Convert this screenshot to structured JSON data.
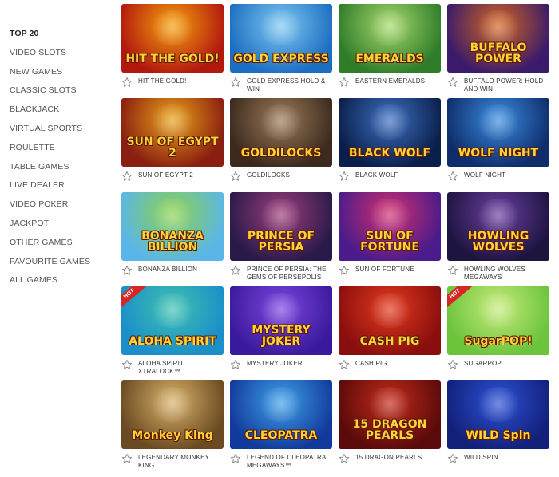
{
  "sidebar": {
    "items": [
      {
        "label": "TOP 20",
        "active": true
      },
      {
        "label": "VIDEO SLOTS"
      },
      {
        "label": "NEW GAMES"
      },
      {
        "label": "CLASSIC SLOTS"
      },
      {
        "label": "BLACKJACK"
      },
      {
        "label": "VIRTUAL SPORTS"
      },
      {
        "label": "ROULETTE"
      },
      {
        "label": "TABLE GAMES"
      },
      {
        "label": "LIVE DEALER"
      },
      {
        "label": "VIDEO POKER"
      },
      {
        "label": "JACKPOT"
      },
      {
        "label": "OTHER GAMES"
      },
      {
        "label": "FAVOURITE GAMES"
      },
      {
        "label": "ALL GAMES"
      }
    ]
  },
  "games": [
    {
      "title": "HIT THE GOLD!",
      "art_text": "HIT THE GOLD!",
      "bg1": "#b3180f",
      "bg2": "#f5a20b",
      "hot": false
    },
    {
      "title": "GOLD EXPRESS HOLD & WIN",
      "art_text": "GOLD EXPRESS",
      "bg1": "#1c6ec2",
      "bg2": "#7ec8f0",
      "hot": false
    },
    {
      "title": "EASTERN EMERALDS",
      "art_text": "EMERALDS",
      "bg1": "#2f7d2a",
      "bg2": "#a7d86b",
      "hot": false
    },
    {
      "title": "BUFFALO POWER: HOLD AND WIN",
      "art_text": "BUFFALO POWER",
      "bg1": "#3a1a6b",
      "bg2": "#d3651f",
      "hot": false
    },
    {
      "title": "SUN OF EGYPT 2",
      "art_text": "SUN OF EGYPT 2",
      "bg1": "#8a1e10",
      "bg2": "#e8a21a",
      "hot": false
    },
    {
      "title": "GOLDILOCKS",
      "art_text": "GOLDILOCKS",
      "bg1": "#3c2a1e",
      "bg2": "#9c7a58",
      "hot": false
    },
    {
      "title": "BLACK WOLF",
      "art_text": "BLACK WOLF",
      "bg1": "#0a1f4a",
      "bg2": "#3d6fc1",
      "hot": false
    },
    {
      "title": "WOLF NIGHT",
      "art_text": "WOLF NIGHT",
      "bg1": "#0f2d6b",
      "bg2": "#3a8be0",
      "hot": false
    },
    {
      "title": "BONANZA BILLION",
      "art_text": "BONANZA BILLION",
      "bg1": "#5bb6e8",
      "bg2": "#8bd14a",
      "hot": false
    },
    {
      "title": "PRINCE OF PERSIA: THE GEMS OF PERSEPOLIS",
      "art_text": "PRINCE OF PERSIA",
      "bg1": "#2a1a4a",
      "bg2": "#9c3d7a",
      "hot": false
    },
    {
      "title": "SUN OF FORTUNE",
      "art_text": "SUN OF FORTUNE",
      "bg1": "#4a1b8a",
      "bg2": "#d12f6e",
      "hot": false
    },
    {
      "title": "HOWLING WOLVES MEGAWAYS",
      "art_text": "HOWLING WOLVES",
      "bg1": "#1e1440",
      "bg2": "#6a3fa0",
      "hot": false
    },
    {
      "title": "ALOHA SPIRIT XTRALOCK™",
      "art_text": "ALOHA SPIRIT",
      "bg1": "#1a8fc9",
      "bg2": "#3fc0b0",
      "hot": true
    },
    {
      "title": "MYSTERY JOKER",
      "art_text": "MYSTERY JOKER",
      "bg1": "#3a1a9c",
      "bg2": "#7d46e0",
      "hot": false
    },
    {
      "title": "CASH PIG",
      "art_text": "CASH PIG",
      "bg1": "#8a0e0e",
      "bg2": "#e23a1d",
      "hot": false
    },
    {
      "title": "SUGARPOP",
      "art_text": "SugarPOP!",
      "bg1": "#6bc43c",
      "bg2": "#c6ea7a",
      "hot": true
    },
    {
      "title": "LEGENDARY MONKEY KING",
      "art_text": "Monkey King",
      "bg1": "#6a4a22",
      "bg2": "#d9b36a",
      "hot": false
    },
    {
      "title": "LEGEND OF CLEOPATRA MEGAWAYS™",
      "art_text": "CLEOPATRA",
      "bg1": "#123a9c",
      "bg2": "#3fa0e8",
      "hot": false
    },
    {
      "title": "15 DRAGON PEARLS",
      "art_text": "15 DRAGON PEARLS",
      "bg1": "#5a0a0a",
      "bg2": "#c22a1a",
      "hot": false
    },
    {
      "title": "WILD SPIN",
      "art_text": "WILD Spin",
      "bg1": "#12207a",
      "bg2": "#2d52d6",
      "hot": false
    }
  ],
  "hot_label": "HOT"
}
